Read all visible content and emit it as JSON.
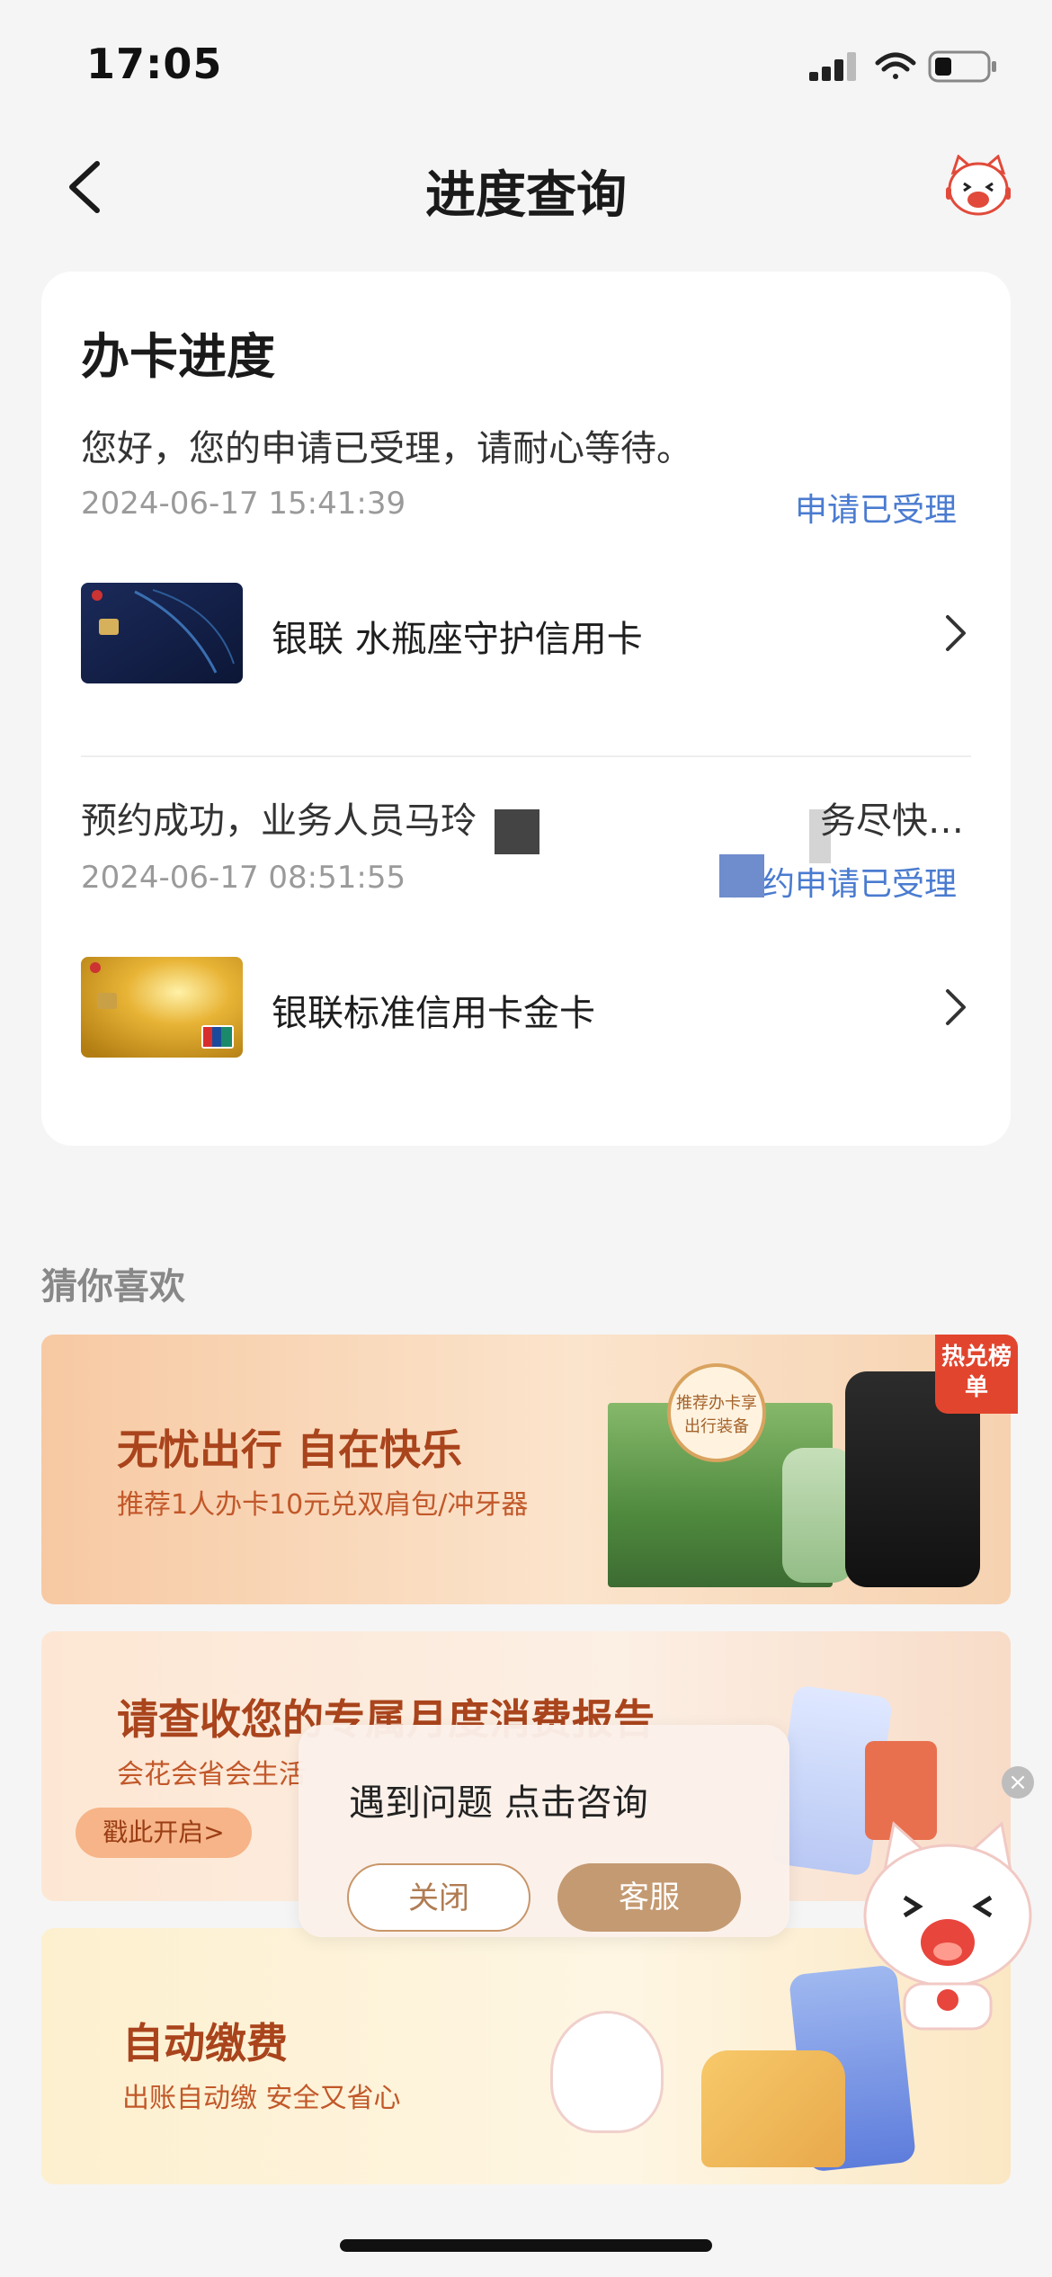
{
  "status_bar": {
    "time": "17:05"
  },
  "nav": {
    "title": "进度查询"
  },
  "progress_card": {
    "title": "办卡进度",
    "entries": [
      {
        "message": "您好，您的申请已受理，请耐心等待。",
        "timestamp": "2024-06-17 15:41:39",
        "status": "申请已受理",
        "card_name": "银联 水瓶座守护信用卡"
      },
      {
        "message": "预约成功，业务人员马玲",
        "message_tail": "务尽快…",
        "timestamp": "2024-06-17 08:51:55",
        "status": "预约申请已受理",
        "card_name": "银联标准信用卡金卡"
      }
    ]
  },
  "recommend": {
    "section_title": "猜你喜欢",
    "banners": [
      {
        "headline": "无忧出行 自在快乐",
        "subline": "推荐1人办卡10元兑双肩包/冲牙器",
        "tag": "热兑榜单",
        "badge": "推荐办卡享出行装备"
      },
      {
        "headline": "请查收您的专属月度消费报告",
        "subline": "会花会省会生活",
        "button": "戳此开启>"
      },
      {
        "headline": "自动缴费",
        "subline": "出账自动缴 安全又省心"
      }
    ]
  },
  "popup": {
    "title": "遇到问题 点击咨询",
    "close_label": "关闭",
    "service_label": "客服"
  },
  "colors": {
    "status_link": "#4a7bd0",
    "accent_gold": "#c49a72",
    "banner_text": "#a9441c"
  }
}
